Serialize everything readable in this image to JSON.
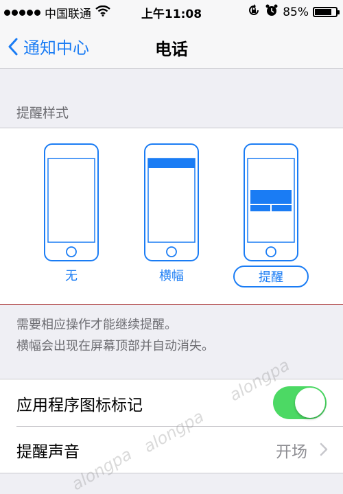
{
  "status_bar": {
    "carrier": "中国联通",
    "time": "上午11:08",
    "battery_percent": "85%",
    "battery_level": 0.85,
    "icons": [
      "signal-dots-icon",
      "wifi-icon",
      "rotation-lock-icon",
      "alarm-icon",
      "battery-icon"
    ]
  },
  "nav": {
    "back_label": "通知中心",
    "title": "电话"
  },
  "alert_style": {
    "header": "提醒样式",
    "options": [
      {
        "label": "无",
        "selected": false
      },
      {
        "label": "横幅",
        "selected": false
      },
      {
        "label": "提醒",
        "selected": true
      }
    ],
    "footer_line1": "需要相应操作才能继续提醒。",
    "footer_line2": "横幅会出现在屏幕顶部并自动消失。"
  },
  "settings": {
    "badge_label": "应用程序图标标记",
    "badge_enabled": true,
    "sound_label": "提醒声音",
    "sound_value": "开场"
  },
  "watermark": "alongpa",
  "colors": {
    "accent": "#1a7cf4",
    "toggle_on": "#4cd964",
    "background": "#efeff4"
  }
}
